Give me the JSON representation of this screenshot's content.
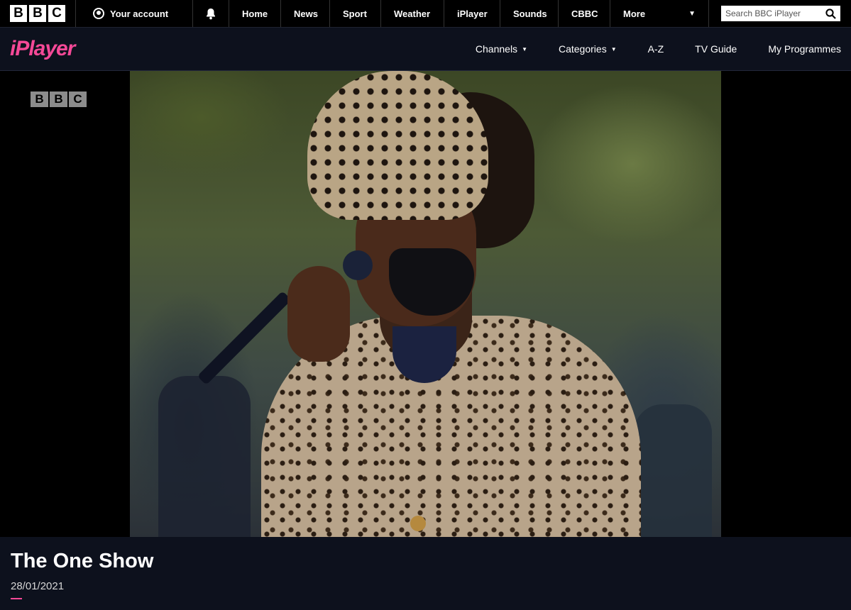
{
  "global_nav": {
    "logo_letters": [
      "B",
      "B",
      "C"
    ],
    "account_label": "Your account",
    "items": [
      {
        "label": "Home"
      },
      {
        "label": "News"
      },
      {
        "label": "Sport"
      },
      {
        "label": "Weather"
      },
      {
        "label": "iPlayer"
      },
      {
        "label": "Sounds"
      },
      {
        "label": "CBBC"
      },
      {
        "label": "More"
      }
    ],
    "search_placeholder": "Search BBC iPlayer"
  },
  "iplayer_nav": {
    "logo": "iPlayer",
    "items": [
      {
        "label": "Channels",
        "has_dropdown": true
      },
      {
        "label": "Categories",
        "has_dropdown": true
      },
      {
        "label": "A-Z",
        "has_dropdown": false
      },
      {
        "label": "TV Guide",
        "has_dropdown": false
      },
      {
        "label": "My Programmes",
        "has_dropdown": false
      }
    ]
  },
  "player": {
    "channel_logo_letters": [
      "B",
      "B",
      "C"
    ]
  },
  "programme": {
    "title": "The One Show",
    "date": "28/01/2021"
  },
  "colors": {
    "accent": "#f54997",
    "background": "#0d111d",
    "global_bar": "#000000"
  }
}
